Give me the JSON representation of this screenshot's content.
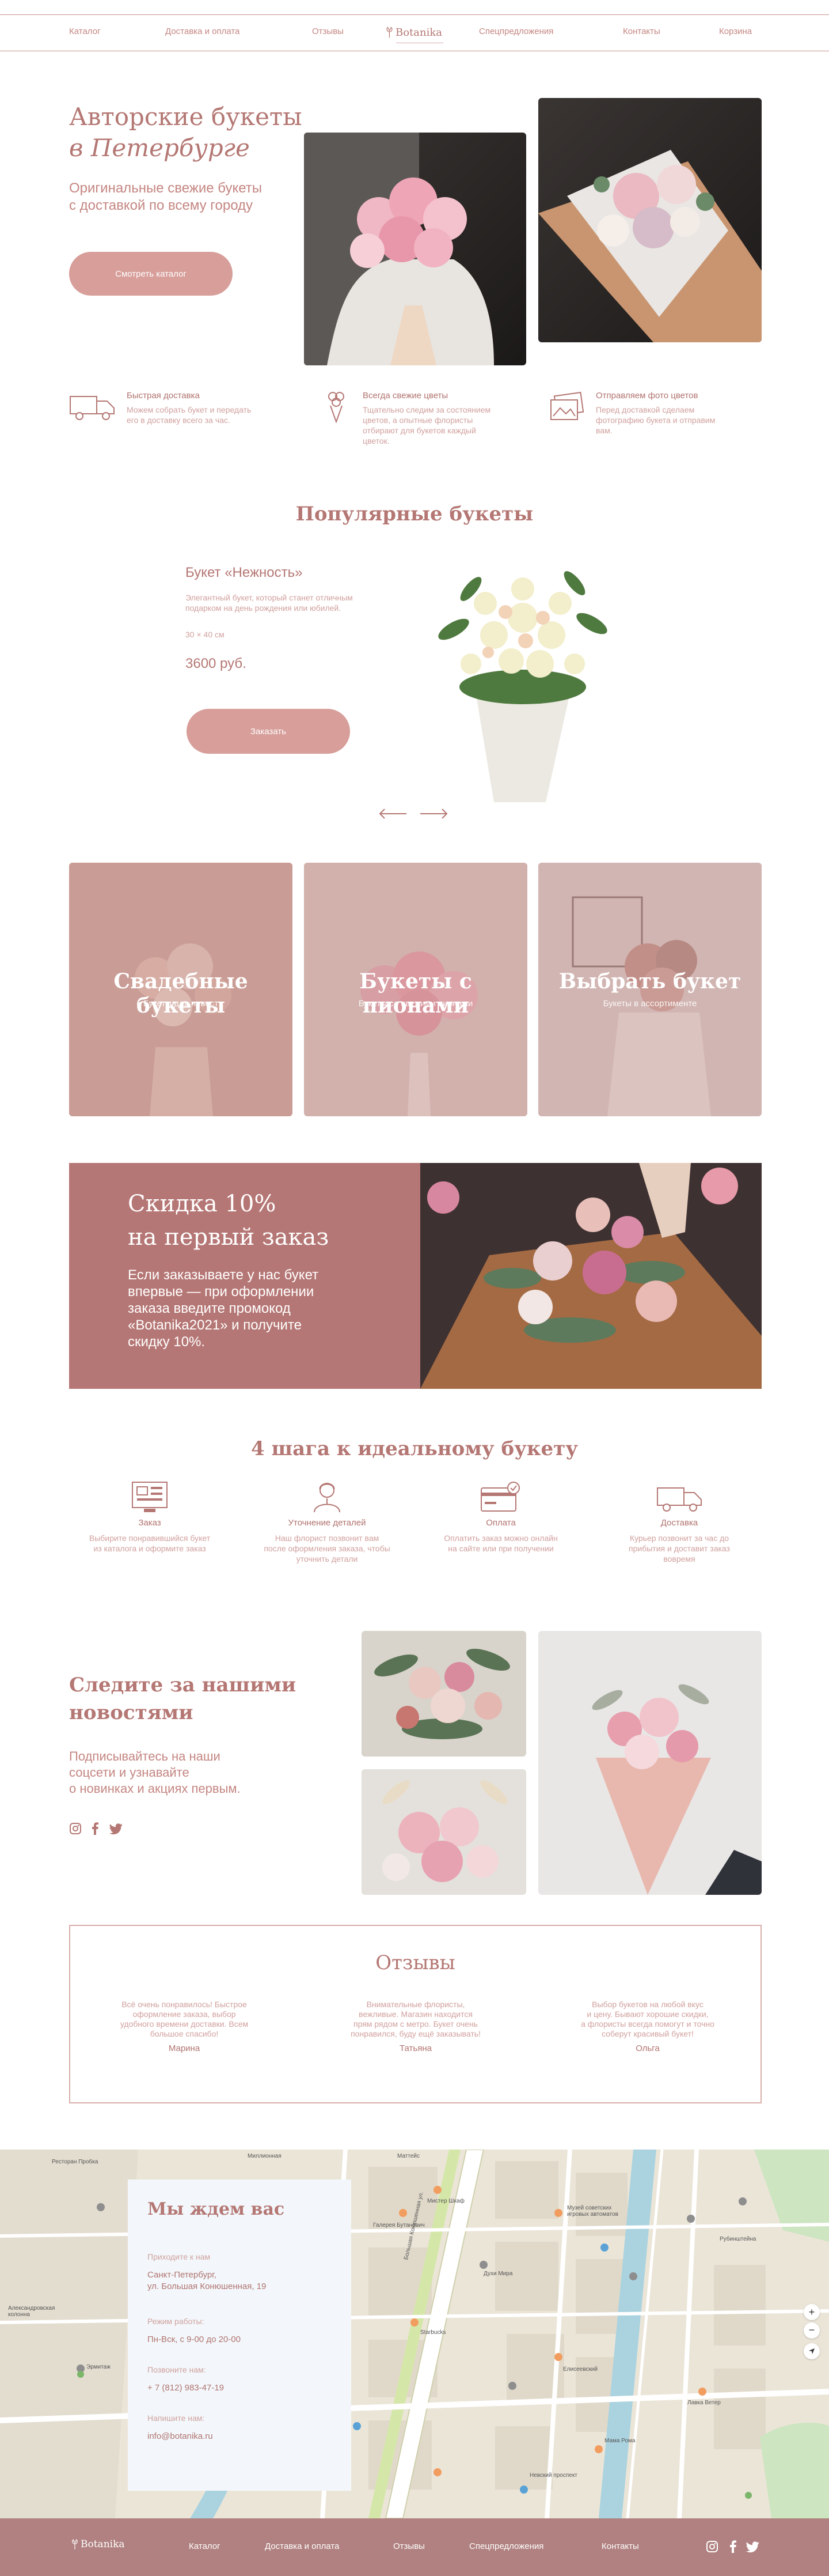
{
  "header": {
    "nav_left": [
      "Каталог",
      "Доставка и оплата",
      "Отзывы"
    ],
    "logo": "Botanika",
    "nav_right": [
      "Спецпредложения",
      "Контакты",
      "Корзина"
    ]
  },
  "hero": {
    "title_line1": "Авторские букеты",
    "title_line2": "в Петербурге",
    "subtitle_line1": "Оригинальные свежие букеты",
    "subtitle_line2": "с доставкой по всему городу",
    "button": "Смотреть каталог"
  },
  "features": [
    {
      "title": "Быстрая доставка",
      "text": [
        "Можем собрать букет и передать",
        "его в доставку всего за час."
      ],
      "icon": "truck-icon"
    },
    {
      "title": "Всегда свежие цветы",
      "text": [
        "Тщательно следим за состоянием",
        "цветов, а опытные флористы",
        "отбирают для букетов каждый",
        "цветок."
      ],
      "icon": "bouquet-icon"
    },
    {
      "title": "Отправляем фото цветов",
      "text": [
        "Перед доставкой сделаем",
        "фотографию букета и отправим",
        "вам."
      ],
      "icon": "photo-icon"
    }
  ],
  "popular": {
    "heading": "Популярные букеты",
    "name": "Букет «Нежность»",
    "desc_line1": "Элегантный букет, который станет отличным",
    "desc_line2": "подарком на день рождения или юбилей.",
    "size": "30 × 40 см",
    "price": "3600 руб.",
    "button": "Заказать"
  },
  "categories": [
    {
      "title": "Свадебные букеты",
      "sub": "Букеты для невест"
    },
    {
      "title": "Букеты с пионами",
      "sub": "Букеты со свежими пионами"
    },
    {
      "title": "Выбрать букет",
      "sub": "Букеты в ассортименте"
    }
  ],
  "promo": {
    "title_line1": "Скидка 10%",
    "title_line2": "на первый заказ",
    "text": [
      "Если заказываете у нас букет",
      "впервые — при оформлении",
      "заказа введите промокод",
      "«Botanika2021» и получите",
      "скидку 10%."
    ]
  },
  "steps": {
    "heading": "4 шага к идеальному букету",
    "items": [
      {
        "title": "Заказ",
        "text": [
          "Выбирите понравившийся букет",
          "из каталога и оформите заказ"
        ],
        "icon": "catalog-icon"
      },
      {
        "title": "Уточнение деталей",
        "text": [
          "Наш флорист позвонит вам",
          "после оформления заказа, чтобы",
          "уточнить детали"
        ],
        "icon": "florist-icon"
      },
      {
        "title": "Оплата",
        "text": [
          "Оплатить заказ можно онлайн",
          "на сайте или при получении"
        ],
        "icon": "card-icon"
      },
      {
        "title": "Доставка",
        "text": [
          "Курьер позвонит за час до",
          "прибытия и доставит заказ",
          "вовремя"
        ],
        "icon": "truck-icon"
      }
    ]
  },
  "social": {
    "title_line1": "Следите за нашими",
    "title_line2": "новостями",
    "text_line1": "Подписывайтесь на наши",
    "text_line2": "соцсети и узнавайте",
    "text_line3": "о новинках и акциях первым.",
    "icons": [
      "instagram-icon",
      "facebook-icon",
      "twitter-icon"
    ]
  },
  "reviews": {
    "heading": "Отзывы",
    "items": [
      {
        "text": [
          "Всё очень понравилось! Быстрое",
          "оформление заказа, выбор",
          "удобного времени доставки. Всем",
          "большое спасибо!"
        ],
        "name": "Марина"
      },
      {
        "text": [
          "Внимательные флористы,",
          "вежливые. Магазин находится",
          "прям рядом с метро. Букет очень",
          "понравился, буду ещё заказывать!"
        ],
        "name": "Татьяна"
      },
      {
        "text": [
          "Выбор букетов на любой вкус",
          "и цену. Бывают хорошие скидки,",
          "а флористы всегда помогут и точно",
          "соберут красивый букет!"
        ],
        "name": "Ольга"
      }
    ]
  },
  "contacts": {
    "heading": "Мы ждем вас",
    "address_label": "Приходите к нам",
    "address_line1": "Санкт-Петербург,",
    "address_line2": "ул. Большая Конюшенная, 19",
    "hours_label": "Режим работы:",
    "hours": "Пн-Вск, с 9-00 до 20-00",
    "phone_label": "Позвоните нам:",
    "phone": "+ 7 (812) 983-47-19",
    "email_label": "Напишите нам:",
    "email": "info@botanika.ru"
  },
  "map_labels": {
    "l1": "Ресторан Пробка",
    "l2": "Александровская колонна",
    "l3": "Эрмитаж",
    "l4": "Миллионная",
    "l5": "Маттейс",
    "l6": "Галерея Бутанович",
    "l7": "Большая Конюшенная ул.",
    "l8": "Мистер Шкаф",
    "l9": "Музей советских игровых автоматов",
    "l10": "Лавка Ветер",
    "l11": "Елисеевский",
    "l12": "Невский проспект",
    "l13": "Мама Рома",
    "l14": "Духи Мира",
    "l15": "Starbucks",
    "l16": "Рубинштейна"
  },
  "footer": {
    "logo": "Botanika",
    "links": [
      "Каталог",
      "Доставка и оплата",
      "Отзывы",
      "Спецпредложения",
      "Контакты"
    ],
    "icons": [
      "instagram-icon",
      "facebook-icon",
      "twitter-icon"
    ]
  },
  "colors": {
    "brand": "#b47773",
    "button": "#d79e9a",
    "promo_bg": "#b57775",
    "footer_bg": "#b08180",
    "card_bg": "#f3f7fb"
  }
}
